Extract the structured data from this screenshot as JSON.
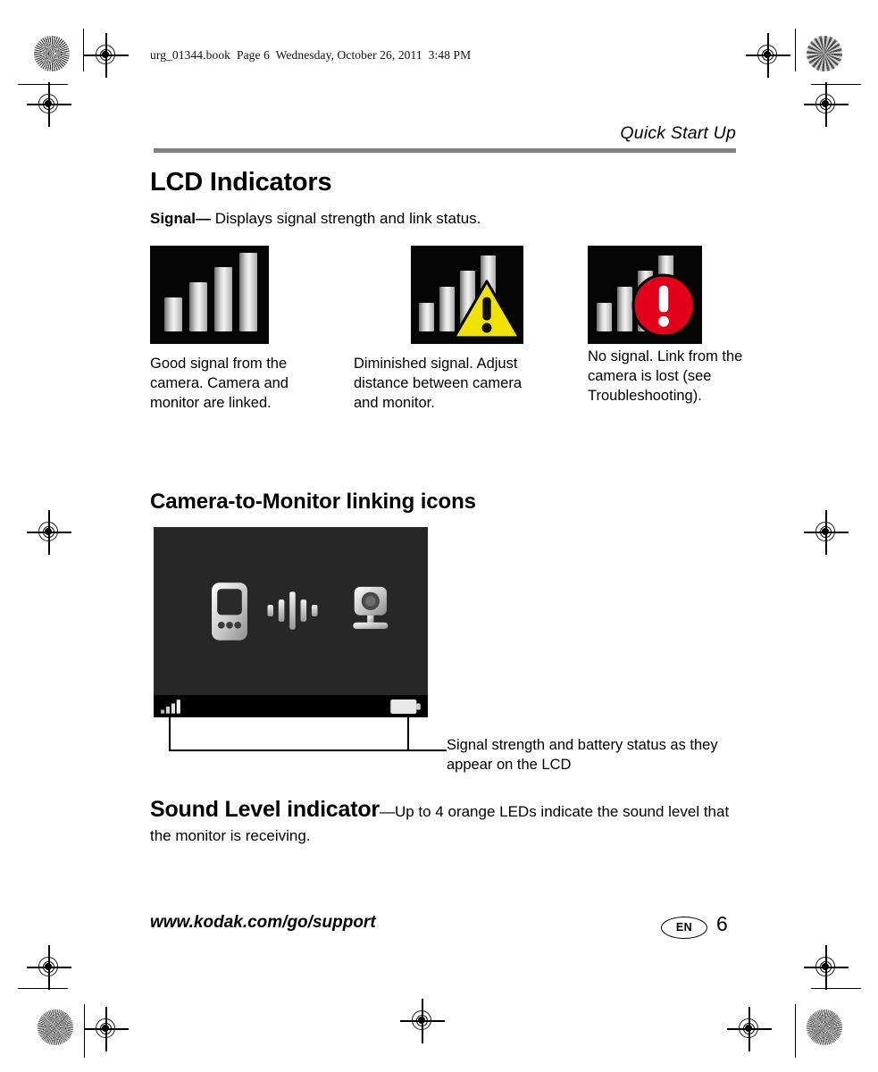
{
  "print_marks": {
    "book_info": "urg_01344.book  Page 6  Wednesday, October 26, 2011  3:48 PM"
  },
  "running_head": {
    "title": "Quick Start Up"
  },
  "sections": {
    "lcd_indicators": {
      "heading": "LCD Indicators",
      "intro_bold": "Signal—",
      "intro_rest": " Displays signal strength and link status.",
      "items": [
        {
          "icon_name": "signal-full-icon",
          "caption": "Good signal from the camera. Camera and monitor are linked."
        },
        {
          "icon_name": "signal-warning-icon",
          "caption": "Diminished signal. Adjust distance between camera and monitor."
        },
        {
          "icon_name": "signal-error-icon",
          "caption": "No signal. Link from the camera is lost (see Troubleshooting)."
        }
      ]
    },
    "linking_icons": {
      "heading": "Camera-to-Monitor linking icons",
      "lcd_screen": {
        "monitor_icon": "handheld-monitor-icon",
        "link_waves_icon": "signal-waves-icon",
        "camera_icon": "camera-icon",
        "status_signal_icon": "signal-bars-icon",
        "status_battery_icon": "battery-icon"
      },
      "callout": "Signal strength and battery status as they appear on the LCD"
    },
    "sound_level": {
      "heading_bold": "Sound Level indicator",
      "body": "—Up to 4 orange LEDs indicate the sound level that the monitor is receiving."
    }
  },
  "footer": {
    "url": "www.kodak.com/go/support",
    "language": "EN",
    "page_number": "6"
  },
  "colors": {
    "rule_gray": "#808080",
    "warning_yellow": "#F2E200",
    "error_red": "#E2001A",
    "lcd_background": "#272727",
    "statusbar_black": "#000000"
  }
}
